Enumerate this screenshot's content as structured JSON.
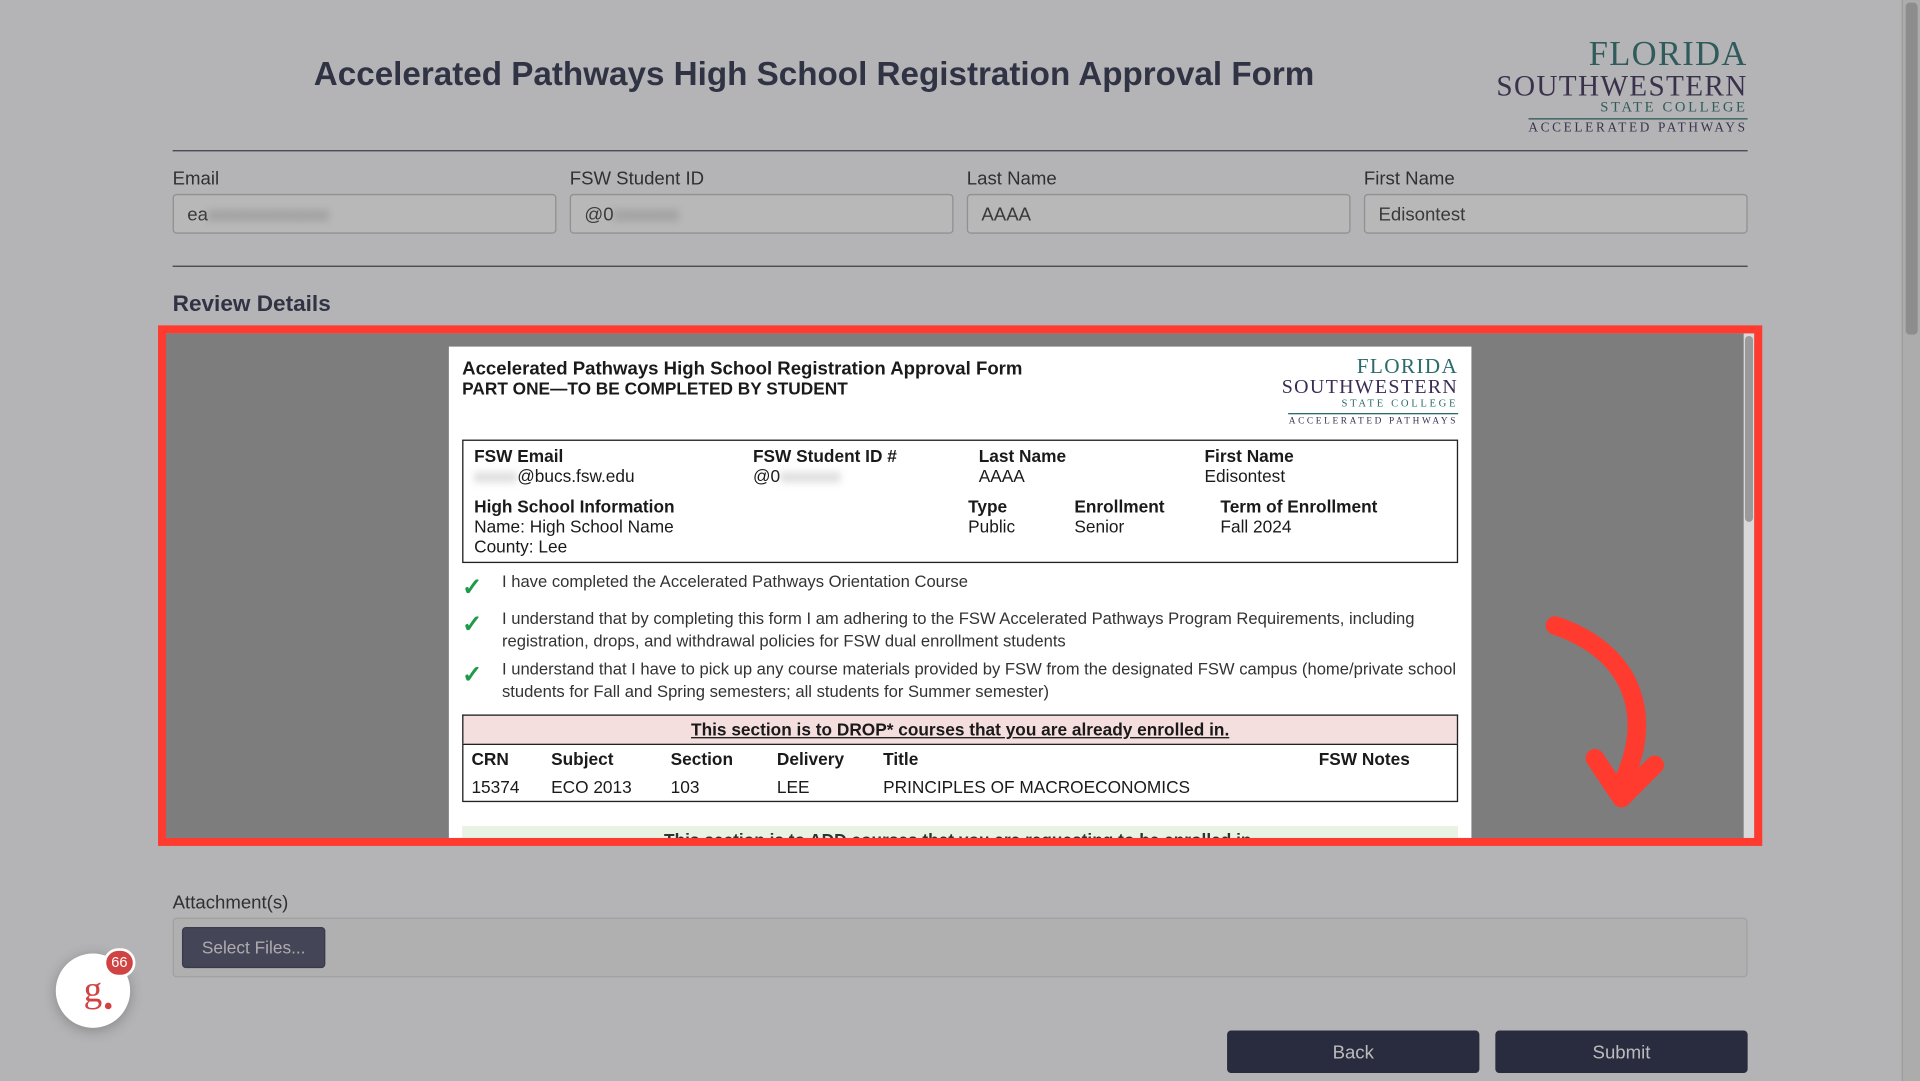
{
  "page": {
    "title": "Accelerated Pathways High School Registration Approval Form"
  },
  "logo": {
    "line1": "FLORIDA",
    "line2": "SOUTHWESTERN",
    "line3": "STATE COLLEGE",
    "line4": "ACCELERATED PATHWAYS"
  },
  "form": {
    "email": {
      "label": "Email",
      "value": "ea"
    },
    "student_id": {
      "label": "FSW Student ID",
      "value": "@0"
    },
    "last_name": {
      "label": "Last Name",
      "value": "AAAA"
    },
    "first_name": {
      "label": "First Name",
      "value": "Edisontest"
    }
  },
  "review": {
    "section_label": "Review Details",
    "doc_title": "Accelerated Pathways High School Registration Approval Form",
    "doc_part": "PART ONE—TO BE COMPLETED BY STUDENT",
    "labels": {
      "email": "FSW Email",
      "id": "FSW Student ID #",
      "last": "Last Name",
      "first": "First Name",
      "hs": "High School Information",
      "type": "Type",
      "enroll": "Enrollment",
      "term": "Term of Enrollment"
    },
    "values": {
      "email": "@bucs.fsw.edu",
      "id": "@0",
      "last": "AAAA",
      "first": "Edisontest",
      "hs_name": "Name: High School Name",
      "hs_county": "County: Lee",
      "type": "Public",
      "enroll": "Senior",
      "term": "Fall 2024"
    },
    "checks": [
      "I have completed the Accelerated Pathways Orientation Course",
      "I understand that by completing this form I am adhering to the FSW Accelerated Pathways Program Requirements, including registration, drops, and withdrawal policies for FSW dual enrollment students",
      "I understand that I have to pick up any course materials provided by FSW from the designated FSW campus (home/private school students for Fall and Spring semesters; all students for Summer semester)"
    ],
    "drop_header": "This section is to DROP* courses that you are already enrolled in.",
    "drop_cols": {
      "crn": "CRN",
      "subject": "Subject",
      "section": "Section",
      "delivery": "Delivery",
      "title": "Title",
      "notes": "FSW Notes"
    },
    "drop_rows": [
      {
        "crn": "15374",
        "subject": "ECO 2013",
        "section": "103",
        "delivery": "LEE",
        "title": "PRINCIPLES OF MACROECONOMICS",
        "notes": ""
      }
    ],
    "add_header": "This section is to ADD courses that you are requesting to be enrolled in."
  },
  "attachments": {
    "label": "Attachment(s)",
    "button": "Select Files..."
  },
  "footer": {
    "back": "Back",
    "submit": "Submit"
  },
  "widget": {
    "glyph": "g",
    "badge": "66"
  }
}
